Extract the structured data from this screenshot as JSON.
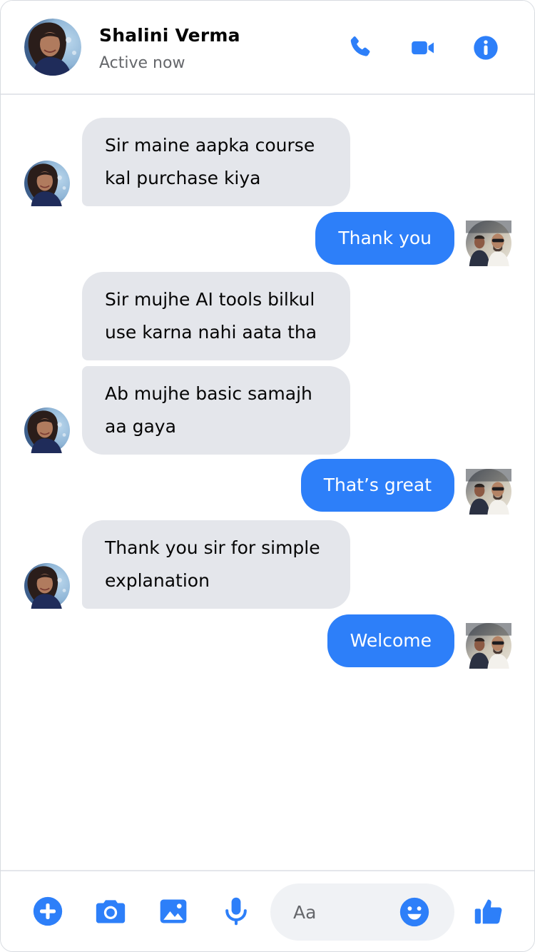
{
  "header": {
    "contact_name": "Shalini Verma",
    "status": "Active now",
    "icons": [
      "phone-icon",
      "video-camera-icon",
      "info-icon"
    ]
  },
  "messages": [
    {
      "direction": "incoming",
      "lines": [
        "Sir maine aapka course",
        "kal purchase kiya"
      ]
    },
    {
      "direction": "outgoing",
      "lines": [
        "Thank you"
      ]
    },
    {
      "direction": "incoming",
      "lines": [
        "Sir mujhe AI tools bilkul",
        "use karna nahi aata tha"
      ]
    },
    {
      "direction": "incoming",
      "lines": [
        "Ab mujhe basic samajh",
        "aa gaya"
      ]
    },
    {
      "direction": "outgoing",
      "lines": [
        "That’s great"
      ]
    },
    {
      "direction": "incoming",
      "lines": [
        "Thank you sir for simple",
        "explanation"
      ]
    },
    {
      "direction": "outgoing",
      "lines": [
        "Welcome"
      ]
    }
  ],
  "composer": {
    "placeholder": "Aa",
    "icons": [
      "plus-icon",
      "camera-icon",
      "image-icon",
      "microphone-icon",
      "emoji-icon",
      "thumbs-up-icon"
    ]
  },
  "colors": {
    "accent": "#2d7ff9",
    "incoming_bubble": "#e4e6eb",
    "outgoing_bubble": "#2d7ff9",
    "status_text": "#65676b",
    "input_background": "#f0f2f5"
  }
}
